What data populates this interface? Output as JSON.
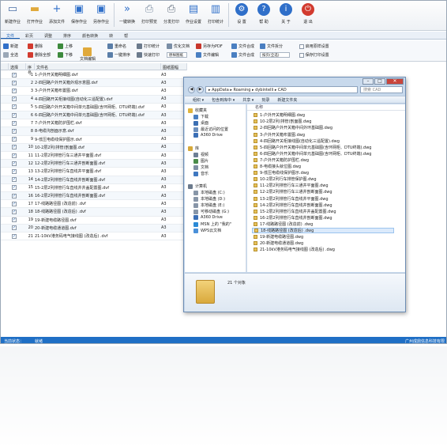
{
  "toolbar": {
    "buttons": [
      {
        "label": "新建作业",
        "icon": "new-file-icon",
        "color": "#4a6fa5"
      },
      {
        "label": "打开作业",
        "icon": "open-folder-icon",
        "color": "#e0a93b"
      },
      {
        "label": "添加文件",
        "icon": "add-icon",
        "color": "#2f6fc9"
      },
      {
        "label": "保存作业",
        "icon": "save-icon",
        "color": "#2f6fc9"
      },
      {
        "label": "另存作业",
        "icon": "save-as-icon",
        "color": "#2f6fc9"
      },
      {
        "label": "一键转换",
        "icon": "convert-icon",
        "color": "#2f6fc9"
      },
      {
        "label": "打印预览",
        "icon": "print-preview-icon",
        "color": "#7a8ba0"
      },
      {
        "label": "分发打印",
        "icon": "print-icon",
        "color": "#5d6a7a"
      },
      {
        "label": "作业设置",
        "icon": "job-settings-icon",
        "color": "#2f6fc9"
      },
      {
        "label": "打印统计",
        "icon": "stats-icon",
        "color": "#2f6fc9"
      },
      {
        "label": "设 置",
        "icon": "gear-icon",
        "color": "#2f6fc9"
      },
      {
        "label": "帮 助",
        "icon": "help-icon",
        "color": "#2f6fc9"
      },
      {
        "label": "关 于",
        "icon": "about-icon",
        "color": "#2f6fc9"
      },
      {
        "label": "退 出",
        "icon": "exit-icon",
        "color": "#d23b2f"
      }
    ]
  },
  "menu_tabs": [
    "文件",
    "彩页",
    "调整",
    "排序",
    "颜色转换",
    "转",
    "帮"
  ],
  "ribbon": {
    "row1": [
      "新建",
      "删除",
      "上移",
      "重命名",
      "打印统计",
      "优化文档",
      "另存为PDF",
      "文件合成",
      "文件拆分",
      "启用原样设置"
    ],
    "row2": [
      "全选",
      "删除全部",
      "下移",
      "一键排序",
      "快速打印",
      "文件编辑",
      "文件合成",
      "按页(全选)",
      "保存打印设置"
    ],
    "mode_select": "按页(全选)",
    "dropdown": "原样图纸",
    "file_edit": "文档编辑"
  },
  "grid": {
    "headers": [
      "",
      "选择",
      "序号",
      "文件名",
      "图纸图幅"
    ],
    "rows": [
      {
        "n": "1",
        "name": "1-户外开关箱明细图.dvf",
        "size": "A3"
      },
      {
        "n": "2",
        "name": "2-四回路户外开关箱外观示意图.dvf",
        "size": "A3"
      },
      {
        "n": "3",
        "name": "3-户外开关箱布置图.dvf",
        "size": "A3"
      },
      {
        "n": "4",
        "name": "4-四回路开关柜接线图(自动化三遥配置).dvf",
        "size": "A3"
      },
      {
        "n": "5",
        "name": "5-四回路户外开关箱中间单元基础图(含环网柜、DTU终端).dvf",
        "size": "A3"
      },
      {
        "n": "6",
        "name": "6-四回路户外开关箱中间单元基础图(含环网柜、DTU终端).dvf",
        "size": "A3"
      },
      {
        "n": "7",
        "name": "7-户外开关箱防护围栏.dvf",
        "size": "A3"
      },
      {
        "n": "8",
        "name": "8-电缆沟剖面示意.dvf",
        "size": "A3"
      },
      {
        "n": "9",
        "name": "9-低压电缆线保护图示.dvf",
        "size": "A3"
      },
      {
        "n": "10",
        "name": "10-2层2列(排管)剖面图.dvf",
        "size": "A3"
      },
      {
        "n": "11",
        "name": "11-2层2列排管行车三通井平面图.dvf",
        "size": "A3"
      },
      {
        "n": "12",
        "name": "12-2层2列排管行车三通井剖断面图.dvf",
        "size": "A3"
      },
      {
        "n": "13",
        "name": "13-2层2列排管行车直线井平面图.dvf",
        "size": "A3"
      },
      {
        "n": "14",
        "name": "14-2层2列排管行车直线井剖断面图.dvf",
        "size": "A3"
      },
      {
        "n": "15",
        "name": "15-2层2列排管行车直线井井盖配置图.dvf",
        "size": "A3"
      },
      {
        "n": "16",
        "name": "16-2层2列排管行车直线井剖断面图.dvf",
        "size": "A3"
      },
      {
        "n": "17",
        "name": "17-线路路径图 (改造前) .dvf",
        "size": "A3"
      },
      {
        "n": "18",
        "name": "18-线路路径图 (改造后) .dvf",
        "size": "A3"
      },
      {
        "n": "19",
        "name": "19-新建电缆路径图.dvf",
        "size": "A3"
      },
      {
        "n": "20",
        "name": "20-新建电缆通道图.dvf",
        "size": "A3"
      },
      {
        "n": "21",
        "name": "21-10kV港务码电气接线图 (改造后) .dvf",
        "size": "A3"
      }
    ]
  },
  "statusbar": {
    "left": "当前状态：",
    "state": "就绪",
    "right": "广州成鼎信息科技有限"
  },
  "explorer": {
    "breadcrumb": "▸ AppData ▸ Roaming ▸ dybintelli ▸ CAD",
    "search_placeholder": "搜索 CAD",
    "commands": [
      "组织 ▾",
      "包含到库中 ▾",
      "共享 ▾",
      "刻录",
      "新建文件夹"
    ],
    "column_header": "名称",
    "nav": [
      {
        "label": "收藏夹",
        "color": "#e0b43c"
      },
      {
        "label": "下载",
        "color": "#4a7fc1"
      },
      {
        "label": "桌面",
        "color": "#3c6fb3"
      },
      {
        "label": "最近访问的位置",
        "color": "#6b8fbd"
      },
      {
        "label": "A360 Drive",
        "color": "#3b6fb6"
      },
      {
        "label": "库",
        "color": "#d7a93a"
      },
      {
        "label": "视频",
        "color": "#6d7f95"
      },
      {
        "label": "图片",
        "color": "#4a8c4a"
      },
      {
        "label": "文档",
        "color": "#7f8fa3"
      },
      {
        "label": "音乐",
        "color": "#3f78c0"
      },
      {
        "label": "计算机",
        "color": "#6c7a8c"
      },
      {
        "label": "本地磁盘 (C:)",
        "color": "#8896a8"
      },
      {
        "label": "本地磁盘 (D:)",
        "color": "#8896a8"
      },
      {
        "label": "本地磁盘 (E:)",
        "color": "#8896a8"
      },
      {
        "label": "可移动磁盘 (G:)",
        "color": "#8896a8"
      },
      {
        "label": "A360 Drive",
        "color": "#3b6fb6"
      },
      {
        "label": "MSN 上的 \"我的\"",
        "color": "#2b8ad6"
      },
      {
        "label": "WPS云文档",
        "color": "#4a90d9"
      }
    ],
    "files": [
      "1-户外开关箱明细图.dwg",
      "10-2层2列(排管)剖面图.dwg",
      "2-四回路户外开关箱中间外环基础图.dwg",
      "3-户外开关箱布置图.dwg",
      "4-四回路开关柜接线图(自动化三遥配置).dwg",
      "5-四回路户外开关箱中间单元基础图(含环网柜、DTU终端).dwg",
      "6-四回路户外开关箱中间单元基础图(含环网柜、DTU终端).dwg",
      "7-户外开关箱防护围栏.dwg",
      "8-电缆接头就位图.dwg",
      "9-低压电缆线保护图示.dwg",
      "10-2层2列行车排管保护图.dwg",
      "11-2层2列排管行车三通井平面图.dwg",
      "12-2层2列排管行车三通井剖断面图.dwg",
      "13-2层2列排管行车直线井平面图.dwg",
      "14-2层2列排管行车直线井剖断面图.dwg",
      "15-2层2列排管行车直线井井盖配置图.dwg",
      "16-2层2列排管行车直线井剖断面图.dwg",
      "17-线路路径图 (改造前) .dwg",
      "18-线路路径图 (改造后) .dwg",
      "19-新建电缆路径图.dwg",
      "20-新建电缆通道图.dwg",
      "21-10kV港务码电气接线图 (改造后) .dwg"
    ],
    "selected_index": 18,
    "item_count": "21 个对象"
  }
}
